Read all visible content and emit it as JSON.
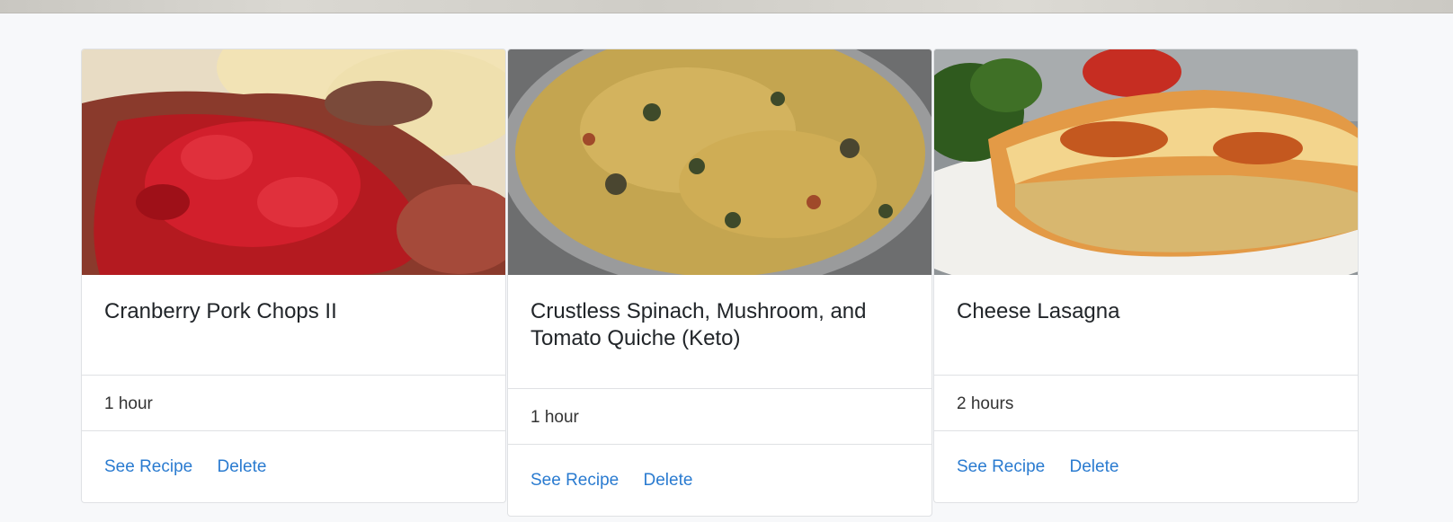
{
  "recipes": [
    {
      "title": "Cranberry Pork Chops II",
      "time": "1 hour",
      "see_label": "See Recipe",
      "delete_label": "Delete"
    },
    {
      "title": "Crustless Spinach, Mushroom, and Tomato Quiche (Keto)",
      "time": "1 hour",
      "see_label": "See Recipe",
      "delete_label": "Delete"
    },
    {
      "title": "Cheese Lasagna",
      "time": "2 hours",
      "see_label": "See Recipe",
      "delete_label": "Delete"
    }
  ]
}
